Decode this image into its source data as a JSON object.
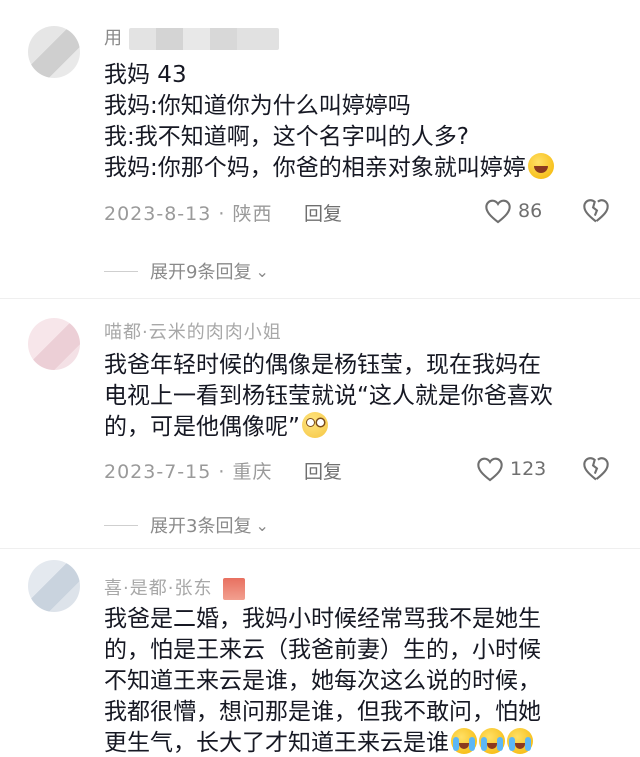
{
  "comments": [
    {
      "username": "用",
      "lines": [
        "我妈 43",
        "我妈:你知道你为什么叫婷婷吗",
        "我:我不知道啊，这个名字叫的人多?",
        "我妈:你那个妈，你爸的相亲对象就叫婷婷"
      ],
      "emoji": "grinning-sweat-emoji",
      "date_location": "2023-8-13 · 陕西",
      "reply_label": "回复",
      "likes": "86",
      "expand_label": "展开9条回复",
      "avatar_color": "#d9d9d9"
    },
    {
      "username": "喵都·云米的肉肉小姐",
      "lines": [
        "我爸年轻时候的偶像是杨钰莹，现在我妈在",
        "电视上一看到杨钰莹就说“这人就是你爸喜欢",
        "的，可是他偶像呢”"
      ],
      "emoji": "eye-roll-emoji",
      "date_location": "2023-7-15 · 重庆",
      "reply_label": "回复",
      "likes": "123",
      "expand_label": "展开3条回复",
      "avatar_color": "#f2dde3"
    },
    {
      "username": "喜·是都·张东",
      "lines": [
        "我爸是二婚，我妈小时候经常骂我不是她生",
        "的，怕是王来云（我爸前妻）生的，小时候",
        "不知道王来云是谁，她每次这么说的时候，",
        "我都很懵，想问那是谁，但我不敢问，怕她",
        "更生气，长大了才知道王来云是谁"
      ],
      "emoji": "crying-laughing-emoji",
      "avatar_color": "#cfd8e3"
    }
  ],
  "colors": {
    "text": "#161823",
    "meta": "#9a9a9a",
    "action": "#6f6f6f"
  }
}
